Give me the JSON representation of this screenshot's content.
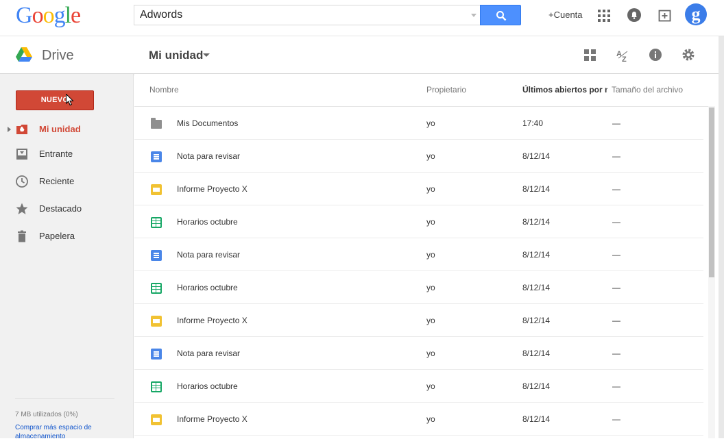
{
  "header": {
    "logo_text": [
      "G",
      "o",
      "o",
      "g",
      "l",
      "e"
    ],
    "logo_colors": [
      "#4285f4",
      "#ea4335",
      "#fbbc05",
      "#4285f4",
      "#34a853",
      "#ea4335"
    ],
    "search_value": "Adwords",
    "cuenta_label": "+Cuenta",
    "avatar_letter": "g"
  },
  "subbar": {
    "app_title": "Drive",
    "folder_title": "Mi unidad"
  },
  "sidebar": {
    "new_button": "NUEVO",
    "items": [
      {
        "label": "Mi unidad",
        "icon": "my-drive-icon",
        "active": true
      },
      {
        "label": "Entrante",
        "icon": "incoming-icon",
        "active": false
      },
      {
        "label": "Reciente",
        "icon": "clock-icon",
        "active": false
      },
      {
        "label": "Destacado",
        "icon": "star-icon",
        "active": false
      },
      {
        "label": "Papelera",
        "icon": "trash-icon",
        "active": false
      }
    ],
    "storage_used": "7 MB utilizados (0%)",
    "storage_link": "Comprar más espacio de almacenamiento"
  },
  "list": {
    "columns": {
      "name": "Nombre",
      "owner": "Propietario",
      "last_opened": "Últimos abiertos por mí",
      "size": "Tamaño del archivo"
    },
    "rows": [
      {
        "type": "folder",
        "name": "Mis Documentos",
        "owner": "yo",
        "date": "17:40",
        "size": "—"
      },
      {
        "type": "doc",
        "name": "Nota para revisar",
        "owner": "yo",
        "date": "8/12/14",
        "size": "—"
      },
      {
        "type": "slide",
        "name": "Informe Proyecto X",
        "owner": "yo",
        "date": "8/12/14",
        "size": "—"
      },
      {
        "type": "sheet",
        "name": "Horarios octubre",
        "owner": "yo",
        "date": "8/12/14",
        "size": "—"
      },
      {
        "type": "doc",
        "name": "Nota para revisar",
        "owner": "yo",
        "date": "8/12/14",
        "size": "—"
      },
      {
        "type": "sheet",
        "name": "Horarios octubre",
        "owner": "yo",
        "date": "8/12/14",
        "size": "—"
      },
      {
        "type": "slide",
        "name": "Informe Proyecto X",
        "owner": "yo",
        "date": "8/12/14",
        "size": "—"
      },
      {
        "type": "doc",
        "name": "Nota para revisar",
        "owner": "yo",
        "date": "8/12/14",
        "size": "—"
      },
      {
        "type": "sheet",
        "name": "Horarios octubre",
        "owner": "yo",
        "date": "8/12/14",
        "size": "—"
      },
      {
        "type": "slide",
        "name": "Informe Proyecto X",
        "owner": "yo",
        "date": "8/12/14",
        "size": "—"
      }
    ]
  },
  "colors": {
    "accent_red": "#d14836",
    "search_blue": "#4d90fe",
    "doc_blue": "#4a86e8",
    "sheet_green": "#16a765",
    "slide_yellow": "#f1c232"
  }
}
